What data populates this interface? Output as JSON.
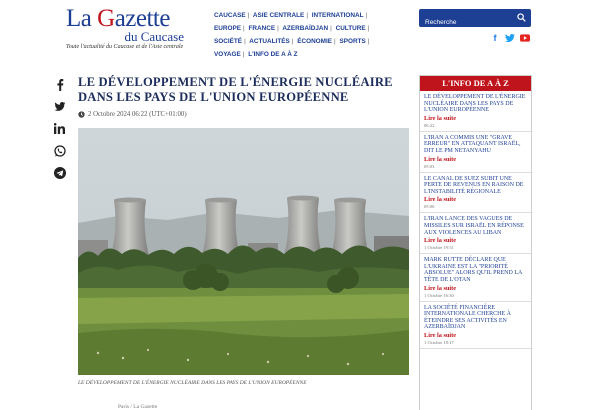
{
  "header": {
    "logo_main_1": "La ",
    "logo_main_2": "G",
    "logo_main_3": "azette",
    "logo_sub": "du Caucase",
    "tagline": "Toute l'actualité du Caucase et de l'Asie centrale"
  },
  "nav": {
    "items": [
      "CAUCASE",
      "ASIE CENTRALE",
      "INTERNATIONAL",
      "EUROPE",
      "FRANCE",
      "AZERBAÏDJAN",
      "CULTURE",
      "SOCIÉTÉ",
      "ACTUALITÉS",
      "ÉCONOMIE",
      "SPORTS",
      "VOYAGE",
      "L'INFO DE A À Z"
    ]
  },
  "search": {
    "placeholder": "Recherche"
  },
  "colors": {
    "brand_blue": "#1d3f94",
    "brand_red": "#c0141c"
  },
  "share_icons": [
    "facebook-icon",
    "twitter-icon",
    "linkedin-icon",
    "whatsapp-icon",
    "telegram-icon"
  ],
  "article": {
    "title": "LE DÉVELOPPEMENT DE L'ÉNERGIE NUCLÉAIRE DANS LES PAYS DE L'UNION EUROPÉENNE",
    "date": "2 Octobre 2024 06:22 (UTC+01:00)",
    "caption": "LE DÉVELOPPEMENT DE L'ÉNERGIE NUCLÉAIRE DANS LES PAYS DE L'UNION EUROPÉENNE",
    "byline": "Paris / La Gazette"
  },
  "sidebar": {
    "heading": "L'INFO DE A À Z",
    "more_label": "Lire la suite",
    "items": [
      {
        "title": "LE DÉVELOPPEMENT DE L'ÉNERGIE NUCLÉAIRE DANS LES PAYS DE L'UNION EUROPÉENNE",
        "time": "06:22"
      },
      {
        "title": "L'IRAN A COMMIS UNE \"GRAVE ERREUR\" EN ATTAQUANT ISRAËL, DIT LE PM NETANYAHU",
        "time": "05:03"
      },
      {
        "title": "LE CANAL DE SUEZ SUBIT UNE PERTE DE REVENUS EN RAISON DE L'INSTABILITÉ RÉGIONALE",
        "time": "05:06"
      },
      {
        "title": "L'IRAN LANCE DES VAGUES DE MISSILES SUR ISRAËL EN RÉPONSE AUX VIOLENCES AU LIBAN",
        "time": "1 Octobre 19:51"
      },
      {
        "title": "MARK RUTTE DÉCLARE QUE L'UKRAINE EST LA \"PRIORITÉ ABSOLUE\" ALORS QU'IL PREND LA TÊTE DE L'OTAN",
        "time": "1 Octobre 16:30"
      },
      {
        "title": "LA SOCIÉTÉ FINANCIÈRE INTERNATIONALE CHERCHE À ÉTEINDRE SES ACTIVITÉS EN AZERBAÏDJAN",
        "time": "1 Octobre 18:17"
      }
    ]
  }
}
